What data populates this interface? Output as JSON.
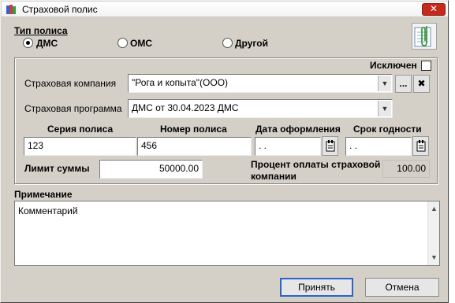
{
  "window": {
    "title": "Страховой полис",
    "close_glyph": "✕"
  },
  "policy_type": {
    "label": "Тип полиса",
    "options": [
      {
        "label": "ДМС",
        "selected": true
      },
      {
        "label": "ОМС",
        "selected": false
      },
      {
        "label": "Другой",
        "selected": false
      }
    ]
  },
  "excluded": {
    "label": "Исключен",
    "checked": false
  },
  "company": {
    "label": "Страховая компания",
    "value": "\"Рога и копыта\"(ООО)",
    "browse_label": "...",
    "clear_label": "✖"
  },
  "program": {
    "label": "Страховая программа",
    "value": "ДМС от 30.04.2023 ДМС"
  },
  "columns": {
    "series_label": "Серия полиса",
    "number_label": "Номер полиса",
    "issue_date_label": "Дата оформления",
    "expiry_label": "Срок годности"
  },
  "values": {
    "series": "123",
    "number": "456",
    "issue_date": " . .",
    "expiry_date": " . ."
  },
  "limit": {
    "label": "Лимит суммы",
    "value": "50000.00"
  },
  "payment_percent": {
    "label_line1": "Процент оплаты страховой",
    "label_line2": "компании",
    "value": "100.00"
  },
  "note": {
    "label": "Примечание",
    "value": "Комментарий"
  },
  "buttons": {
    "accept": "Принять",
    "cancel": "Отмена"
  },
  "icons": {
    "title": "app-icon",
    "clip": "paperclip-icon",
    "calendar": "calendar-icon",
    "combo": "chevron-down-icon"
  },
  "colors": {
    "window_bg": "#d4d0c8",
    "close_red": "#c42b1c",
    "default_button_border": "#2b64c8"
  }
}
